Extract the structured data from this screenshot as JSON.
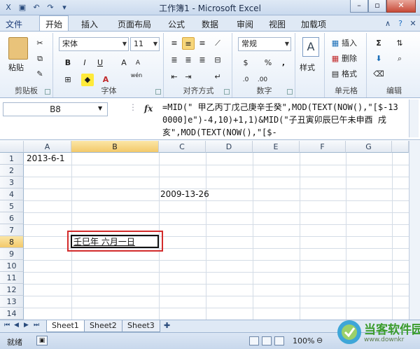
{
  "window": {
    "title": "工作簿1 - Microsoft Excel",
    "minimize": "–",
    "restore": "▫",
    "close": "✕"
  },
  "tabs": [
    {
      "label": "文件"
    },
    {
      "label": "开始"
    },
    {
      "label": "插入"
    },
    {
      "label": "页面布局"
    },
    {
      "label": "公式"
    },
    {
      "label": "数据"
    },
    {
      "label": "审阅"
    },
    {
      "label": "视图"
    },
    {
      "label": "加载项"
    }
  ],
  "ribbon": {
    "clipboard": {
      "paste": "粘贴",
      "label": "剪贴板"
    },
    "font": {
      "name": "宋体",
      "size": "11",
      "bold": "B",
      "italic": "I",
      "underline": "U",
      "label": "字体",
      "wen": "wén"
    },
    "alignment": {
      "label": "对齐方式"
    },
    "number": {
      "format": "常规",
      "percent": "%",
      "comma": ",",
      "label": "数字"
    },
    "styles": {
      "button": "样式"
    },
    "cells": {
      "insert": "插入",
      "delete": "删除",
      "format": "格式",
      "label": "单元格"
    },
    "editing": {
      "sum": "Σ",
      "label": "编辑"
    }
  },
  "formula_bar": {
    "name_box": "B8",
    "fx": "fx",
    "formula": "=MID(\" 甲乙丙丁戊己庚辛壬癸\",MOD(TEXT(NOW(),\"[$-130000]e\")-4,10)+1,1)&MID(\"子丑寅卯辰巳午未申酉 戌亥\",MOD(TEXT(NOW(),\"[$-"
  },
  "grid": {
    "columns": [
      "A",
      "B",
      "C",
      "D",
      "E",
      "F",
      "G"
    ],
    "rows": [
      "1",
      "2",
      "3",
      "4",
      "5",
      "6",
      "7",
      "8",
      "9",
      "10",
      "11",
      "12",
      "13",
      "14"
    ],
    "cells": {
      "A1": "2013-6-1",
      "C4": "2009-13-26",
      "B8": "壬巳年 六月一日"
    }
  },
  "sheets": [
    "Sheet1",
    "Sheet2",
    "Sheet3"
  ],
  "status": {
    "ready": "就绪",
    "zoom": "100%"
  },
  "watermark": {
    "title": "当客软件园",
    "url": "www.downkr"
  }
}
